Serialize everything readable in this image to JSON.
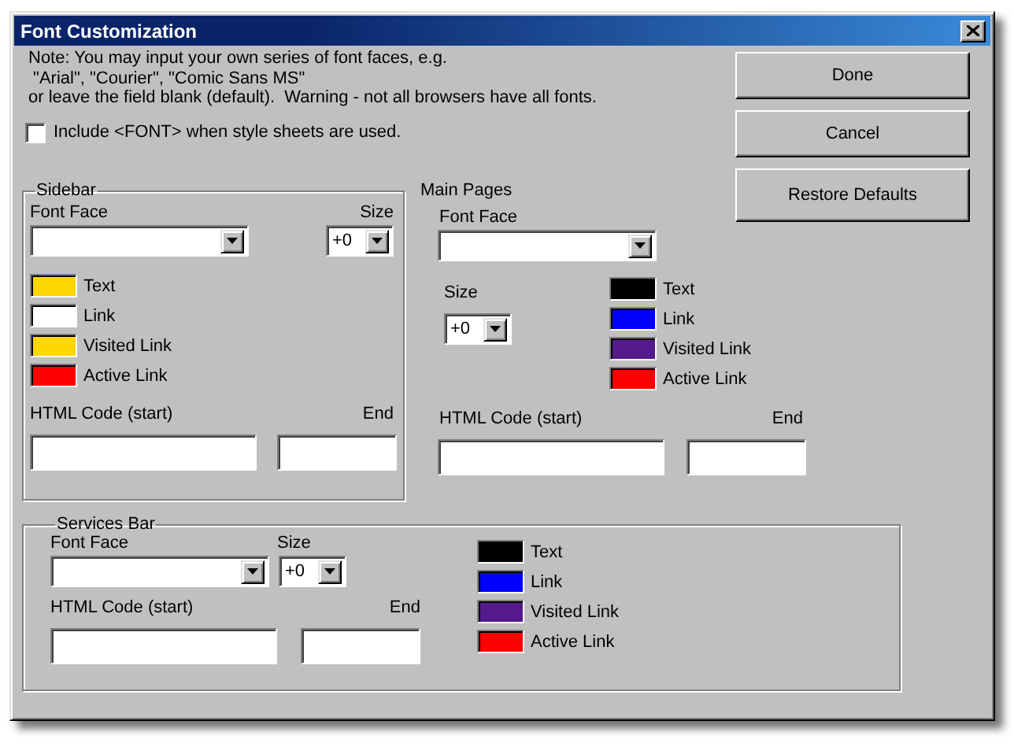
{
  "window": {
    "title": "Font Customization"
  },
  "note_lines": [
    "Note: You may input your own series of font faces, e.g.",
    " \"Arial\", \"Courier\", \"Comic Sans MS\"",
    "or leave the field blank (default).  Warning - not all browsers have all fonts."
  ],
  "include_font": {
    "label": "Include <FONT> when style sheets are used.",
    "checked": false
  },
  "buttons": [
    "Done",
    "Cancel",
    "Restore Defaults"
  ],
  "sidebar": {
    "title": "Sidebar",
    "font_face_label": "Font Face",
    "size_label": "Size",
    "size": "+0",
    "html_start_label": "HTML Code (start)",
    "end_label": "End",
    "colors": [
      {
        "label": "Text",
        "color": "#ffd700"
      },
      {
        "label": "Link",
        "color": "#ffffff"
      },
      {
        "label": "Visited Link",
        "color": "#ffd700"
      },
      {
        "label": "Active Link",
        "color": "#ff0000"
      }
    ]
  },
  "main_pages": {
    "title": "Main Pages",
    "font_face_label": "Font Face",
    "size_label": "Size",
    "size": "+0",
    "html_start_label": "HTML Code (start)",
    "end_label": "End",
    "colors": [
      {
        "label": "Text",
        "color": "#000000"
      },
      {
        "label": "Link",
        "color": "#0000ff"
      },
      {
        "label": "Visited Link",
        "color": "#551a8b"
      },
      {
        "label": "Active Link",
        "color": "#ff0000"
      }
    ]
  },
  "services_bar": {
    "title": "Services Bar",
    "font_face_label": "Font Face",
    "size_label": "Size",
    "size": "+0",
    "html_start_label": "HTML Code (start)",
    "end_label": "End",
    "colors": [
      {
        "label": "Text",
        "color": "#000000"
      },
      {
        "label": "Link",
        "color": "#0000ff"
      },
      {
        "label": "Visited Link",
        "color": "#551a8b"
      },
      {
        "label": "Active Link",
        "color": "#ff0000"
      }
    ]
  }
}
